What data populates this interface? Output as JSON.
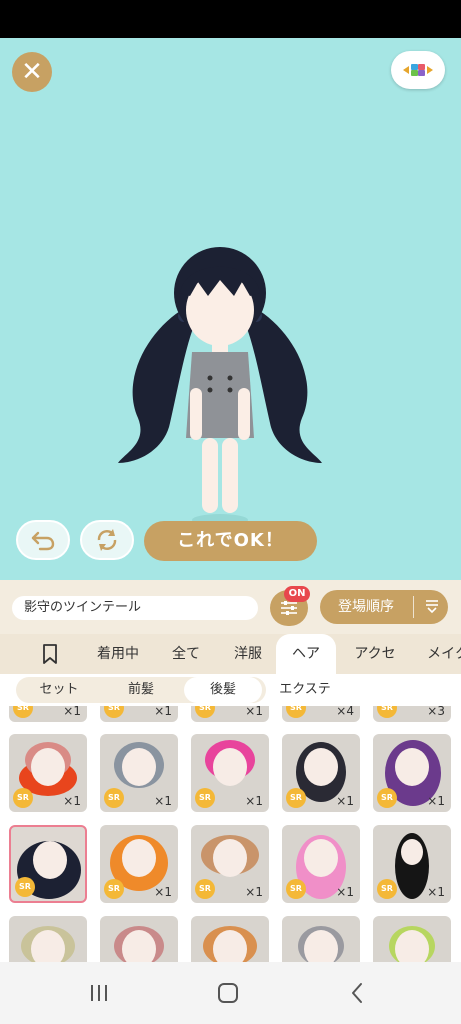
{
  "colors": {
    "accent": "#c7a163",
    "stage_bg": "#a6e6e4",
    "badge_red": "#e8474d",
    "sr_gold": "#f4b837"
  },
  "header": {
    "close_icon": "close-icon",
    "palette_icon": "palette-icon"
  },
  "controls": {
    "undo_icon": "undo-icon",
    "refresh_icon": "refresh-icon",
    "ok_label": "これでOK！"
  },
  "namebar": {
    "item_name": "影守のツインテール",
    "filter_icon": "sliders-icon",
    "filter_badge": "ON",
    "sort_label": "登場順序",
    "sort_icon": "sort-icon"
  },
  "tabs": {
    "bookmark_icon": "bookmark-icon",
    "items": [
      "着用中",
      "全て",
      "洋服",
      "ヘア",
      "アクセ",
      "メイク"
    ],
    "active": "ヘア"
  },
  "subtabs": {
    "items": [
      "セット",
      "前髪",
      "後髪",
      "エクステ"
    ],
    "active": "後髪"
  },
  "grid": {
    "top_row_qty": [
      "×1",
      "×1",
      "×1",
      "×4",
      "×3"
    ],
    "rows": [
      [
        {
          "rarity": "SR",
          "qty": "×1"
        },
        {
          "rarity": "SR",
          "qty": "×1"
        },
        {
          "rarity": "SR",
          "qty": "×1"
        },
        {
          "rarity": "SR",
          "qty": "×1"
        },
        {
          "rarity": "SR",
          "qty": "×1"
        }
      ],
      [
        {
          "rarity": "SR",
          "qty": "",
          "selected": true
        },
        {
          "rarity": "SR",
          "qty": "×1"
        },
        {
          "rarity": "SR",
          "qty": "×1"
        },
        {
          "rarity": "SR",
          "qty": "×1"
        },
        {
          "rarity": "SR",
          "qty": "×1"
        }
      ]
    ]
  },
  "navbar": {
    "recent_icon": "recent-apps-icon",
    "home_icon": "home-icon",
    "back_icon": "back-icon"
  }
}
